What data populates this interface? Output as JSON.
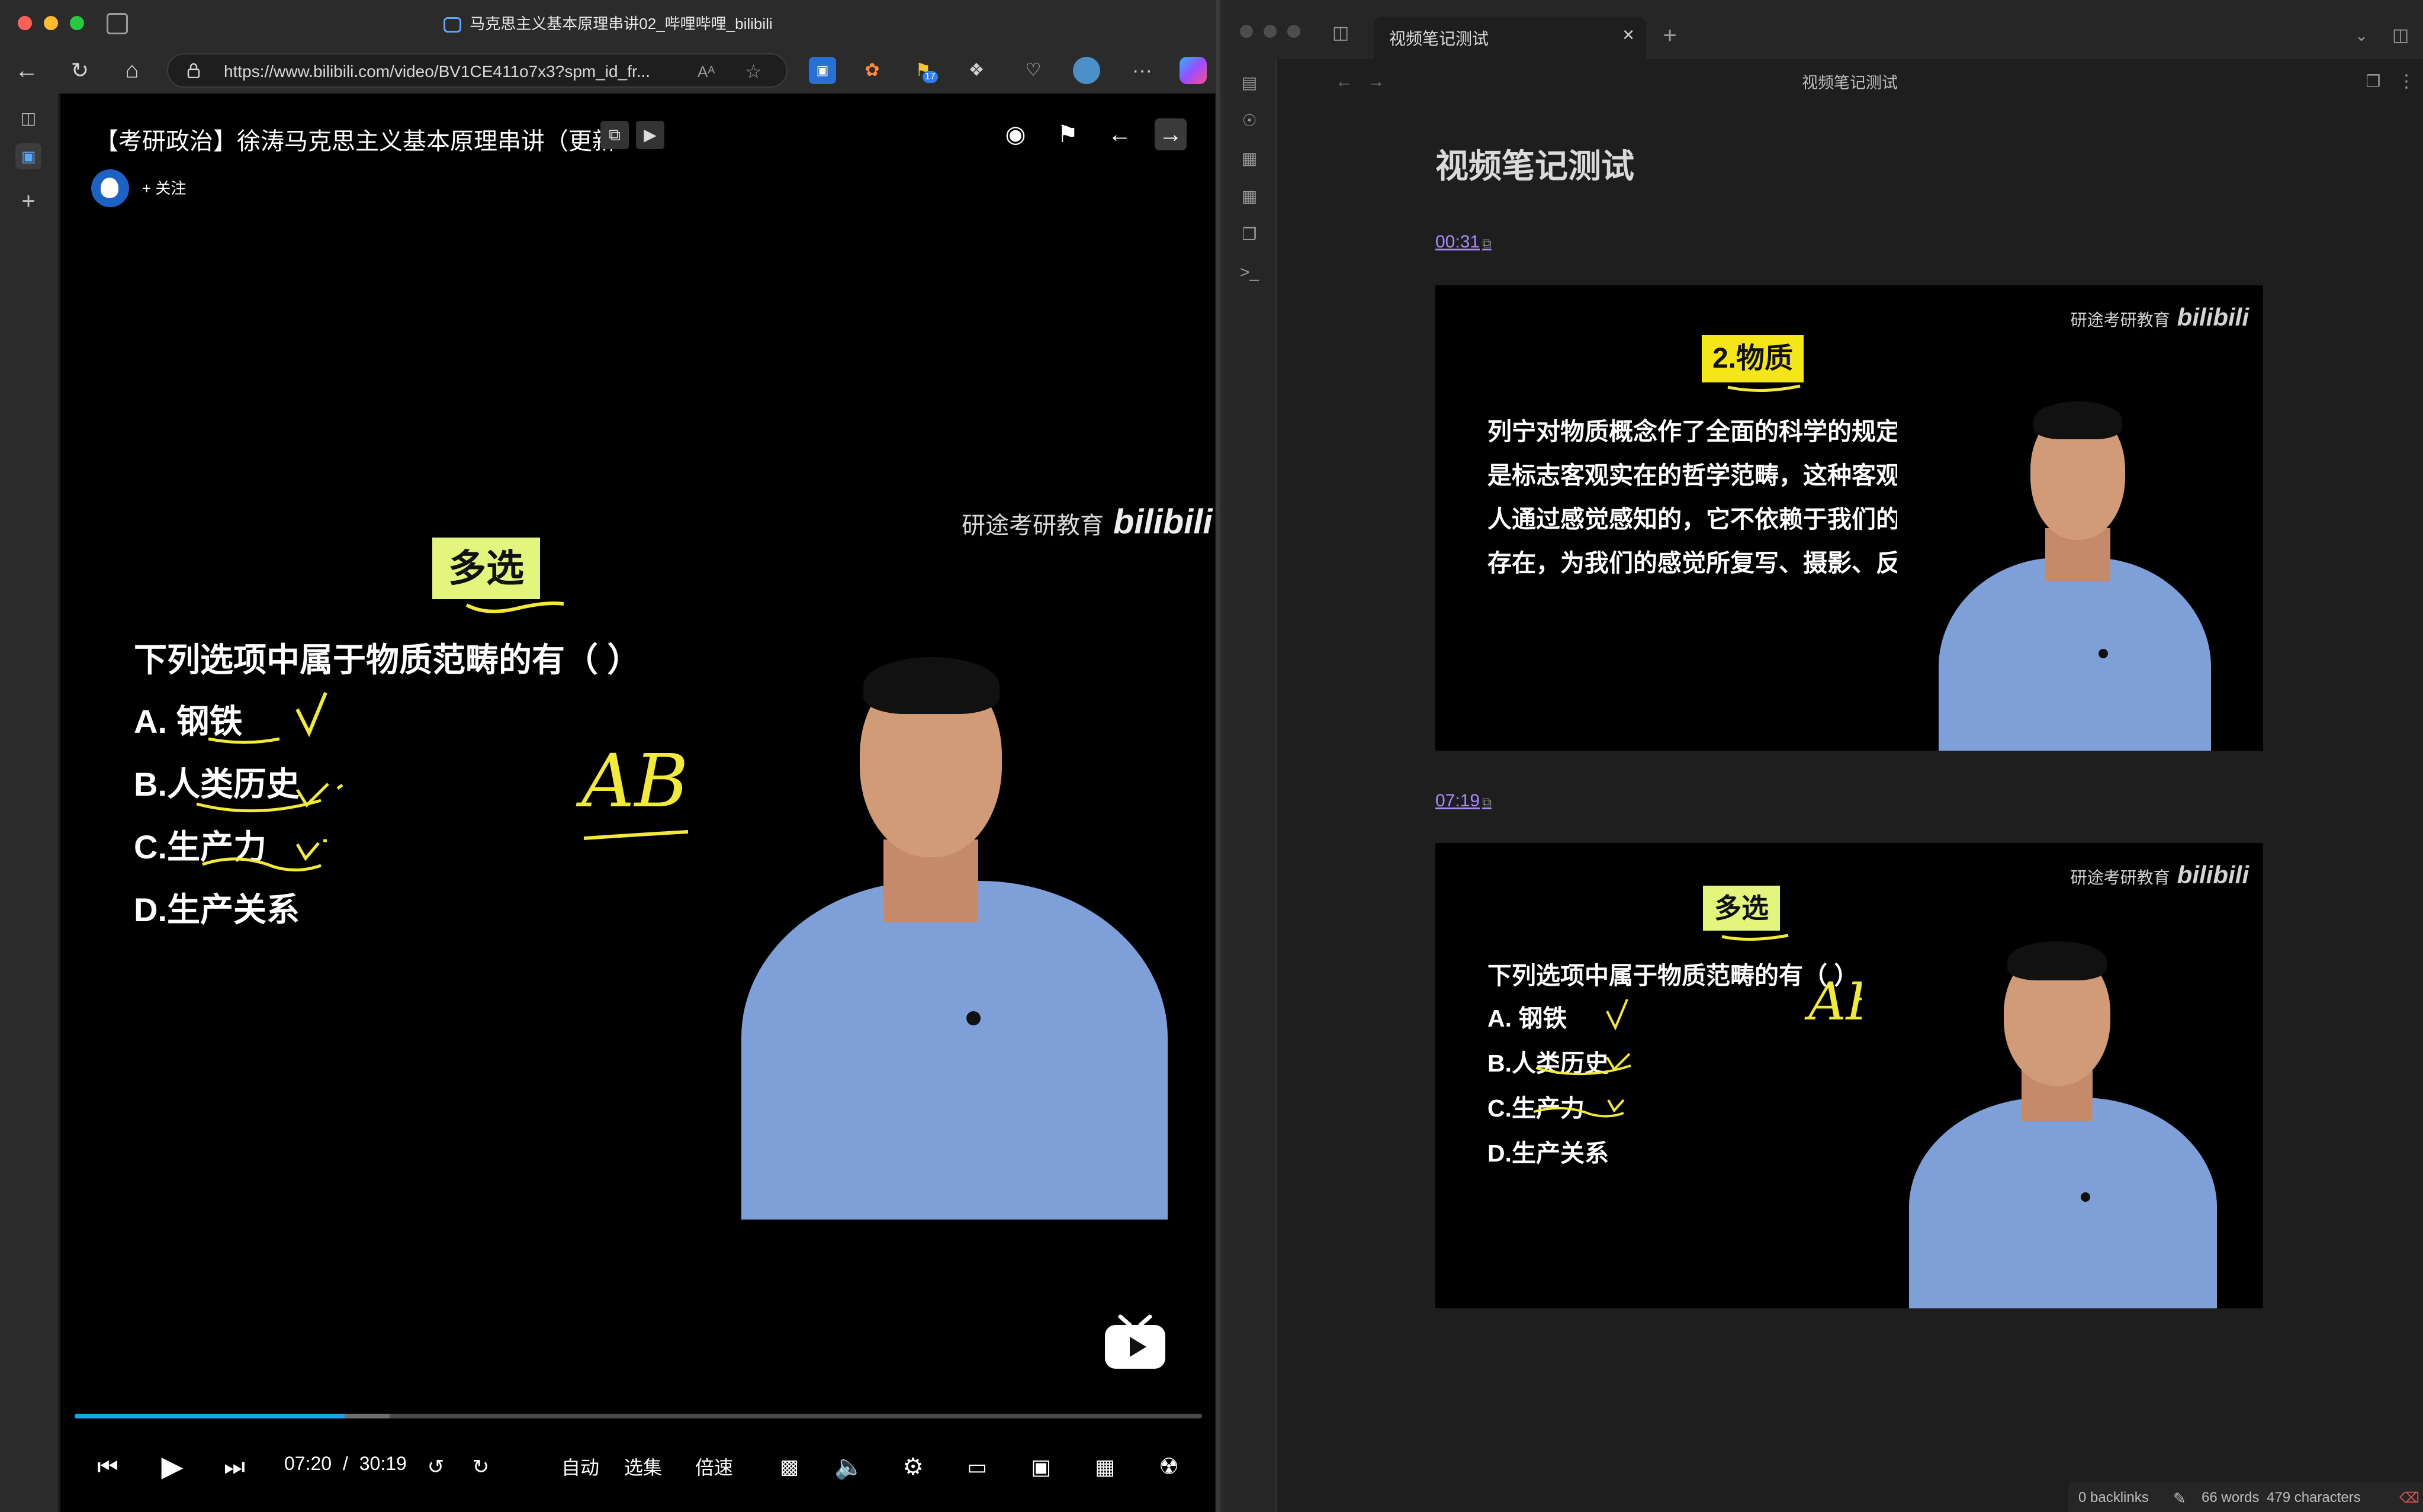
{
  "browser": {
    "window_title": "马克思主义基本原理串讲02_哔哩哔哩_bilibili",
    "url": "https://www.bilibili.com/video/BV1CE411o7x3?spm_id_fr...",
    "read_aloud": "Aᴬ",
    "ext_badge": "17",
    "more": "···"
  },
  "player": {
    "title": "【考研政治】徐涛马克思主义基本原理串讲（更新",
    "follow_label": "+ 关注",
    "watermark": "研途考研教育",
    "watermark_logo": "bilibili",
    "slide": {
      "tag": "多选",
      "question": "下列选项中属于物质范畴的有（ ）",
      "options": [
        "A. 钢铁",
        "B.人类历史",
        "C.生产力",
        "D.生产关系"
      ],
      "handwriting": "AB.C"
    },
    "time_current": "07:20",
    "time_sep": "/",
    "time_total": "30:19",
    "progress": 0.24,
    "buffered": 0.28,
    "auto_label": "自动",
    "episodes_label": "选集",
    "speed_label": "倍速"
  },
  "obsidian": {
    "tab_title": "视频笔记测试",
    "header_title": "视频笔记测试",
    "note_title": "视频笔记测试",
    "entries": [
      {
        "timestamp": "00:31",
        "slide_tag": "2.物质",
        "slide_text": "列宁对物质概念作了全面的科学的规定：“物质是标志客观实在的哲学范畴，这种客观实在是人通过感觉感知的，它不依赖于我们的感觉而存在，为我们的感觉所复写、摄影、反映"
      },
      {
        "timestamp": "07:19",
        "slide_tag": "多选",
        "question": "下列选项中属于物质范畴的有（ ）",
        "options": [
          "A. 钢铁",
          "B.人类历史",
          "C.生产力",
          "D.生产关系"
        ],
        "handwriting": "AB.C"
      }
    ],
    "status": {
      "backlinks": "0 backlinks",
      "words": "66 words",
      "characters": "479 characters"
    }
  },
  "colors": {
    "bilibili_blue": "#1ea0e6",
    "slide_tag_yellow": "#e4f57e",
    "handwriting_yellow": "#f2ea3a",
    "link_purple": "#a88cf5"
  }
}
